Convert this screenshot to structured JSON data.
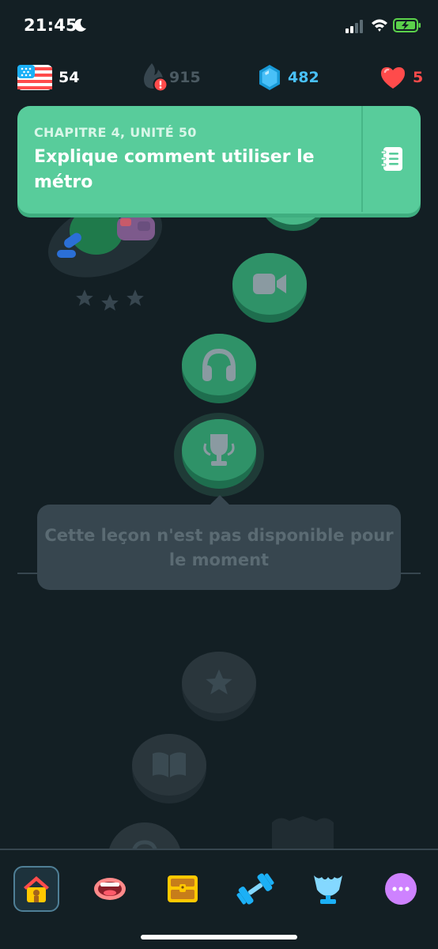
{
  "status_bar": {
    "time": "21:45",
    "icons": [
      "moon-icon",
      "cellular-signal-icon",
      "wifi-icon",
      "battery-charging-icon"
    ]
  },
  "stats": {
    "course_flag": "us-flag-icon",
    "course_count": "54",
    "streak_count": "915",
    "gems_count": "482",
    "hearts_count": "5"
  },
  "unit": {
    "chapter": "CHAPITRE 4, UNITÉ 50",
    "title": "Explique comment utiliser le métro",
    "guidebook_icon": "notebook-icon"
  },
  "tooltip": {
    "text": "Cette leçon n'est pas disponible pour le moment"
  },
  "path_nodes": [
    {
      "icon": "video-camera-icon",
      "state": "unlocked"
    },
    {
      "icon": "headphones-icon",
      "state": "unlocked"
    },
    {
      "icon": "trophy-icon",
      "state": "unlocked"
    },
    {
      "icon": "star-icon",
      "state": "locked"
    },
    {
      "icon": "book-icon",
      "state": "locked"
    }
  ],
  "nav": {
    "items": [
      {
        "name": "home",
        "icon": "house-icon",
        "active": true
      },
      {
        "name": "speak",
        "icon": "mouth-icon",
        "active": false
      },
      {
        "name": "chest",
        "icon": "treasure-chest-icon",
        "active": false
      },
      {
        "name": "practice",
        "icon": "dumbbell-icon",
        "active": false
      },
      {
        "name": "leaderboard",
        "icon": "trophy-cup-icon",
        "active": false
      },
      {
        "name": "more",
        "icon": "more-dots-icon",
        "active": false
      }
    ]
  },
  "colors": {
    "background": "#131f24",
    "unit_green": "#58cc9b",
    "gem_blue": "#49c0f8",
    "heart_red": "#ff4b4b",
    "tooltip_bg": "#37464f"
  }
}
